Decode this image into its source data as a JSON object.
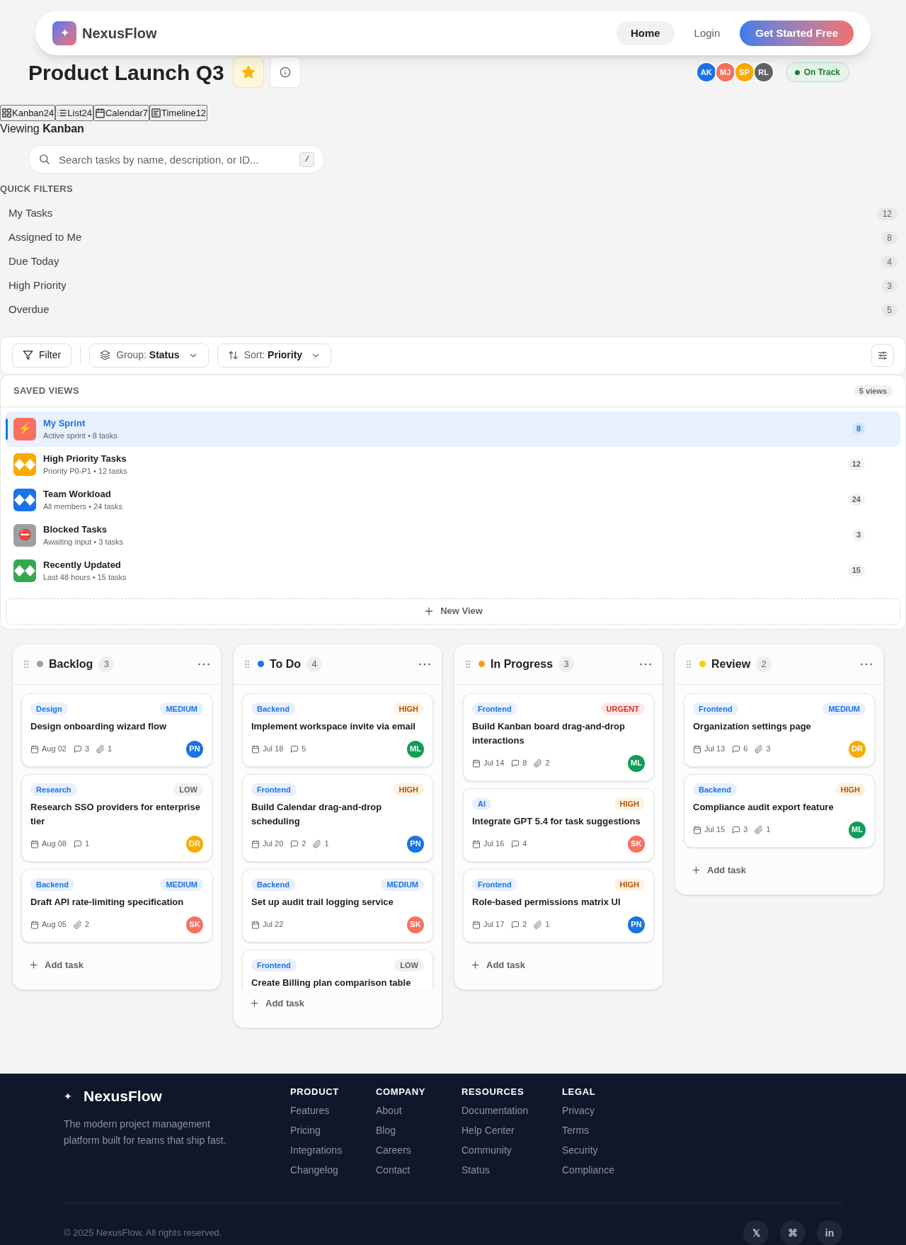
{
  "nav": {
    "brand": "NexusFlow",
    "logo": "✦",
    "links": [
      {
        "label": "Home",
        "selected": true
      },
      {
        "label": "Login",
        "selected": false
      }
    ],
    "cta": "Get Started Free"
  },
  "project": {
    "title": "Product Launch Q3",
    "starred": true,
    "members": [
      {
        "initials": "AK",
        "color": "#1a73e8"
      },
      {
        "initials": "MJ",
        "color": "#f87060"
      },
      {
        "initials": "SP",
        "color": "#f9ab00"
      },
      {
        "initials": "RL",
        "color": "#5f6368"
      }
    ],
    "status": "On Track"
  },
  "view_tabs": [
    {
      "kind": "kanban",
      "label": "Kanban",
      "count": "24"
    },
    {
      "kind": "list",
      "label": "List",
      "count": "24"
    },
    {
      "kind": "calendar",
      "label": "Calendar",
      "count": "7"
    },
    {
      "kind": "timeline",
      "label": "Timeline",
      "count": "12"
    }
  ],
  "viewing": "Viewing **Kanban**",
  "search": {
    "placeholder": "Search tasks by name, description, or ID...",
    "shortcut": "/"
  },
  "quick_filters": {
    "title": "QUICK FILTERS",
    "items": [
      {
        "label": "My Tasks",
        "count": "12"
      },
      {
        "label": "Assigned to Me",
        "count": "8"
      },
      {
        "label": "Due Today",
        "count": "4"
      },
      {
        "label": "High Priority",
        "count": "3"
      },
      {
        "label": "Overdue",
        "count": "5"
      }
    ]
  },
  "toolbar": {
    "filter": "Filter",
    "group_label": "Group:",
    "group_value": "Status",
    "sort_label": "Sort:",
    "sort_value": "Priority"
  },
  "saved_views": {
    "title": "SAVED VIEWS",
    "total": "5 views",
    "items": [
      {
        "icon": "⚡",
        "title": "My Sprint",
        "subtitle": "Active sprint • 8 tasks",
        "count": "8",
        "color": "#f87060",
        "selected": true
      },
      {
        "title": "High Priority Tasks",
        "subtitle": "Priority P0-P1 • 12 tasks",
        "count": "12",
        "color": "#f9ab00",
        "selected": false
      },
      {
        "title": "Team Workload",
        "subtitle": "All members • 24 tasks",
        "count": "24",
        "color": "#1a73e8",
        "selected": false
      },
      {
        "icon": "⛔",
        "title": "Blocked Tasks",
        "subtitle": "Awaiting input • 3 tasks",
        "count": "3",
        "color": "#9aa0a6",
        "selected": false
      },
      {
        "title": "Recently Updated",
        "subtitle": "Last 48 hours • 15 tasks",
        "count": "15",
        "color": "#34a853",
        "selected": false
      }
    ],
    "new_view": "New View"
  },
  "columns": [
    {
      "name": "Backlog",
      "count": "3",
      "color": "#9aa0a6",
      "add": "Add task",
      "cards": [
        {
          "tag": "Design",
          "priority": {
            "label": "MEDIUM",
            "kind": "medium"
          },
          "title": "Design onboarding wizard flow",
          "due": "Aug 02",
          "comments": "3",
          "attachments": "1",
          "assignee": {
            "initials": "PN",
            "color": "#1a73e8"
          }
        },
        {
          "tag": "Research",
          "priority": {
            "label": "LOW",
            "kind": "low"
          },
          "title": "Research SSO providers for enterprise tier",
          "due": "Aug 08",
          "comments": "1",
          "assignee": {
            "initials": "DR",
            "color": "#f9ab00"
          }
        },
        {
          "tag": "Backend",
          "priority": {
            "label": "MEDIUM",
            "kind": "medium"
          },
          "title": "Draft API rate-limiting specification",
          "due": "Aug 05",
          "attachments": "2",
          "assignee": {
            "initials": "SK",
            "color": "#f87060"
          }
        }
      ]
    },
    {
      "name": "To Do",
      "count": "4",
      "color": "#1a73e8",
      "add": "Add task",
      "cards": [
        {
          "tag": "Backend",
          "priority": {
            "label": "HIGH",
            "kind": "high"
          },
          "title": "Implement workspace invite via email",
          "due": "Jul 18",
          "comments": "5",
          "assignee": {
            "initials": "ML",
            "color": "#0f9d58"
          }
        },
        {
          "tag": "Frontend",
          "priority": {
            "label": "HIGH",
            "kind": "high"
          },
          "title": "Build Calendar drag-and-drop scheduling",
          "due": "Jul 20",
          "comments": "2",
          "attachments": "1",
          "assignee": {
            "initials": "PN",
            "color": "#1a73e8"
          }
        },
        {
          "tag": "Backend",
          "priority": {
            "label": "MEDIUM",
            "kind": "medium"
          },
          "title": "Set up audit trail logging service",
          "due": "Jul 22",
          "assignee": {
            "initials": "SK",
            "color": "#f87060"
          }
        },
        {
          "tag": "Frontend",
          "priority": {
            "label": "LOW",
            "kind": "low"
          },
          "title": "Create Billing plan comparison table"
        }
      ]
    },
    {
      "name": "In Progress",
      "count": "3",
      "color": "#f9a00f",
      "add": "Add task",
      "cards": [
        {
          "tag": "Frontend",
          "priority": {
            "label": "URGENT",
            "kind": "urgent"
          },
          "title": "Build Kanban board drag-and-drop interactions",
          "due": "Jul 14",
          "comments": "8",
          "attachments": "2",
          "assignee": {
            "initials": "ML",
            "color": "#0f9d58"
          }
        },
        {
          "tag": "AI",
          "priority": {
            "label": "HIGH",
            "kind": "high"
          },
          "title": "Integrate GPT 5.4 for task suggestions",
          "due": "Jul 16",
          "comments": "4",
          "assignee": {
            "initials": "SK",
            "color": "#f87060"
          }
        },
        {
          "tag": "Frontend",
          "priority": {
            "label": "HIGH",
            "kind": "high"
          },
          "title": "Role-based permissions matrix UI",
          "due": "Jul 17",
          "comments": "2",
          "attachments": "1",
          "assignee": {
            "initials": "PN",
            "color": "#1a73e8"
          }
        }
      ]
    },
    {
      "name": "Review",
      "count": "2",
      "color": "#fbcc05",
      "add": "Add task",
      "cards": [
        {
          "tag": "Frontend",
          "priority": {
            "label": "MEDIUM",
            "kind": "medium"
          },
          "title": "Organization settings page",
          "due": "Jul 13",
          "comments": "6",
          "attachments": "3",
          "assignee": {
            "initials": "DR",
            "color": "#f9ab00"
          }
        },
        {
          "tag": "Backend",
          "priority": {
            "label": "HIGH",
            "kind": "high"
          },
          "title": "Compliance audit export feature",
          "due": "Jul 15",
          "comments": "3",
          "attachments": "1",
          "assignee": {
            "initials": "ML",
            "color": "#0f9d58"
          }
        }
      ]
    }
  ],
  "footer": {
    "brand": "NexusFlow",
    "logo": "✦",
    "tagline": "The modern project management platform built for teams that ship fast.",
    "columns": [
      {
        "heading": "PRODUCT",
        "links": [
          "Features",
          "Pricing",
          "Integrations",
          "Changelog"
        ]
      },
      {
        "heading": "COMPANY",
        "links": [
          "About",
          "Blog",
          "Careers",
          "Contact"
        ]
      },
      {
        "heading": "RESOURCES",
        "links": [
          "Documentation",
          "Help Center",
          "Community",
          "Status"
        ]
      },
      {
        "heading": "LEGAL",
        "links": [
          "Privacy",
          "Terms",
          "Security",
          "Compliance"
        ]
      }
    ],
    "copyright": "© 2025 NexusFlow. All rights reserved.",
    "social": [
      "𝕏",
      "⌘",
      "in"
    ]
  }
}
